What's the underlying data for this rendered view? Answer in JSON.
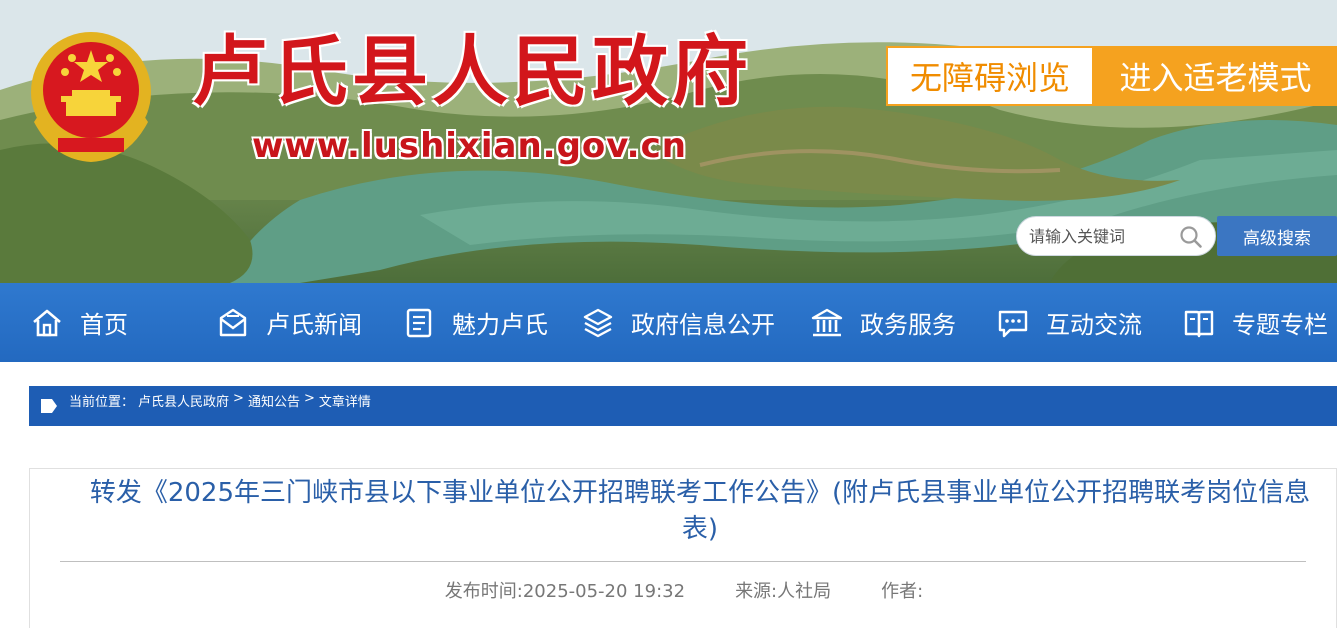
{
  "header": {
    "site_title": "卢氏县人民政府",
    "site_url": "www.lushixian.gov.cn",
    "accessibility_label": "无障碍浏览",
    "elder_mode_label": "进入适老模式",
    "search_placeholder": "请输入关键词",
    "advanced_search_label": "高级搜索"
  },
  "nav": {
    "items": [
      {
        "label": "首页",
        "icon": "home-icon"
      },
      {
        "label": "卢氏新闻",
        "icon": "mail-icon"
      },
      {
        "label": "魅力卢氏",
        "icon": "document-icon"
      },
      {
        "label": "政府信息公开",
        "icon": "layers-icon"
      },
      {
        "label": "政务服务",
        "icon": "government-building-icon"
      },
      {
        "label": "互动交流",
        "icon": "chat-icon"
      },
      {
        "label": "专题专栏",
        "icon": "book-icon"
      }
    ]
  },
  "breadcrumb": {
    "prefix": "当前位置：",
    "items": [
      "卢氏县人民政府",
      "通知公告",
      "文章详情"
    ],
    "separator": ">"
  },
  "article": {
    "title": "转发《2025年三门峡市县以下事业单位公开招聘联考工作公告》(附卢氏县事业单位公开招聘联考岗位信息表)",
    "publish_time": "发布时间:2025-05-20 19:32",
    "source": "来源:人社局",
    "author": "作者:"
  },
  "colors": {
    "title_red": "#d2161b",
    "orange": "#f5a21f",
    "nav_blue": "#2369c0",
    "crumb_blue": "#1e5db4",
    "article_title_blue": "#2a5fa8"
  }
}
